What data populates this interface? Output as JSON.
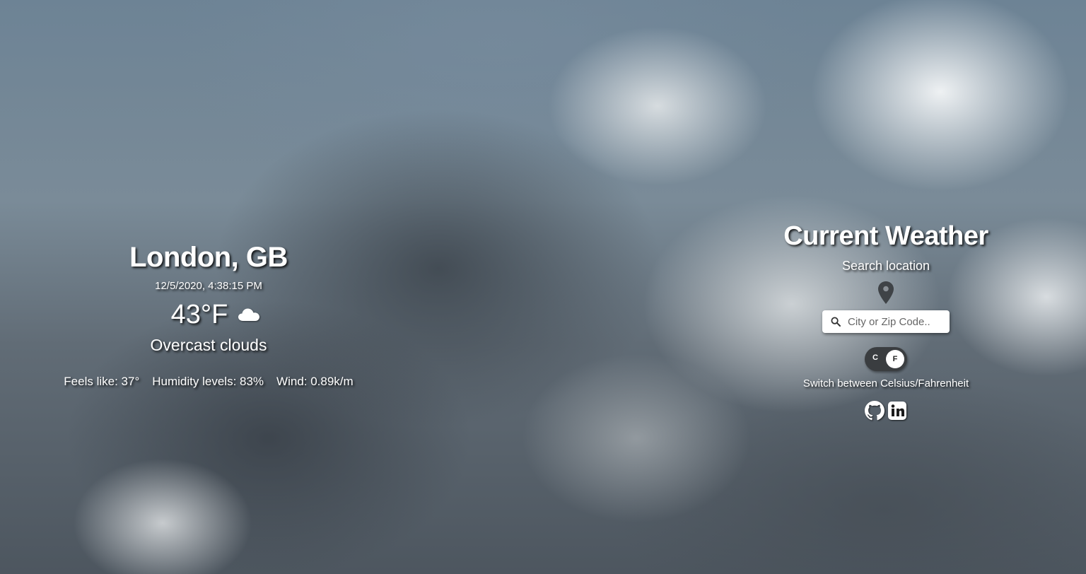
{
  "weather": {
    "city": "London, GB",
    "datetime": "12/5/2020, 4:38:15 PM",
    "temperature": "43°F",
    "condition_icon": "cloud-icon",
    "description": "Overcast clouds",
    "feels_like": "Feels like: 37°",
    "humidity": "Humidity levels: 83%",
    "wind": "Wind: 0.89k/m"
  },
  "sidebar": {
    "title": "Current Weather",
    "search_label": "Search location",
    "location_icon": "map-pin-icon",
    "search_placeholder": "City or Zip Code..",
    "search_icon": "search-icon",
    "unit_toggle": {
      "left_label": "C",
      "right_label": "F",
      "selected": "F"
    },
    "switch_label": "Switch between Celsius/Fahrenheit",
    "social_icons": [
      "github-icon",
      "linkedin-icon"
    ]
  },
  "colors": {
    "text": "#ffffff",
    "toggle_track": "#3a3d40",
    "pin": "#3f4347"
  }
}
